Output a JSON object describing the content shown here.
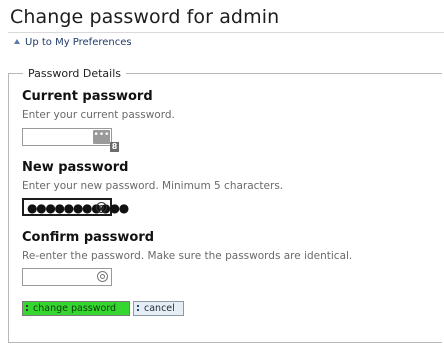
{
  "page": {
    "title": "Change password for admin",
    "back_link": "Up to My Preferences"
  },
  "form": {
    "legend": "Password Details",
    "current_password": {
      "label": "Current password",
      "hint": "Enter your current password.",
      "value": "",
      "password_manager_badge": "•••",
      "password_manager_count": "8"
    },
    "new_password": {
      "label": "New password",
      "hint": "Enter your new password. Minimum 5 characters.",
      "masked_value": "●●●●●●●●●●●"
    },
    "confirm_password": {
      "label": "Confirm password",
      "hint": "Re-enter the password. Make sure the passwords are identical.",
      "value": ""
    },
    "submit_label": "change password",
    "cancel_label": "cancel"
  },
  "colors": {
    "primary_button": "#36d630",
    "link": "#1f3a6b"
  },
  "icons": {
    "back": "up-arrow-icon",
    "password_manager": "password-manager-icon",
    "reveal": "reveal-password-icon",
    "button_grip": "button-grip-icon"
  }
}
